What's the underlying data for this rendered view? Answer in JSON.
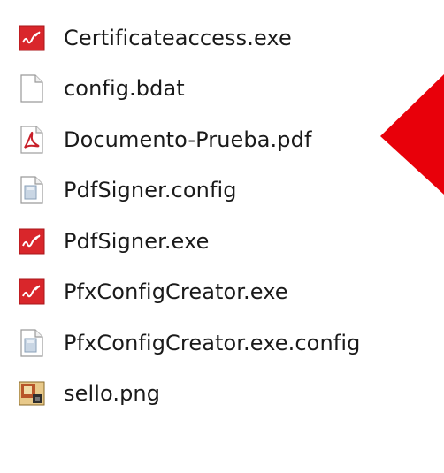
{
  "files": [
    {
      "name": "Certificateaccess.exe",
      "icon": "signer-exe-icon"
    },
    {
      "name": "config.bdat",
      "icon": "blank-file-icon"
    },
    {
      "name": "Documento-Prueba.pdf",
      "icon": "pdf-file-icon"
    },
    {
      "name": "PdfSigner.config",
      "icon": "config-file-icon"
    },
    {
      "name": "PdfSigner.exe",
      "icon": "signer-exe-icon"
    },
    {
      "name": "PfxConfigCreator.exe",
      "icon": "signer-exe-icon"
    },
    {
      "name": "PfxConfigCreator.exe.config",
      "icon": "config-file-icon"
    },
    {
      "name": "sello.png",
      "icon": "png-image-icon"
    }
  ],
  "colors": {
    "arrow": "#e8000a",
    "exe_icon": "#d9262b",
    "pdf_icon": "#c8202a"
  }
}
